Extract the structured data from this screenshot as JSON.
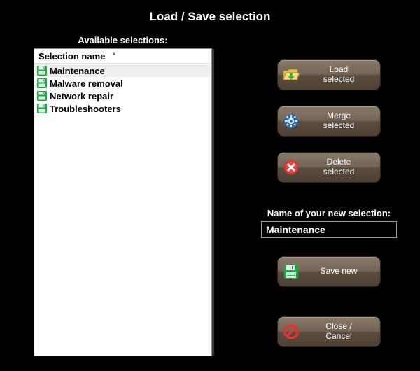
{
  "title": "Load / Save selection",
  "available_label": "Available selections:",
  "list_header": "Selection name",
  "selections": [
    {
      "label": "Maintenance",
      "selected": true
    },
    {
      "label": "Malware removal",
      "selected": false
    },
    {
      "label": "Network repair",
      "selected": false
    },
    {
      "label": "Troubleshooters",
      "selected": false
    }
  ],
  "buttons": {
    "load": "Load\nselected",
    "merge": "Merge\nselected",
    "delete": "Delete\nselected",
    "save": "Save new",
    "close": "Close /\nCancel"
  },
  "new_selection_label": "Name of your new selection:",
  "new_selection_value": "Maintenance",
  "icons": {
    "floppy_color": "#1fa648"
  }
}
